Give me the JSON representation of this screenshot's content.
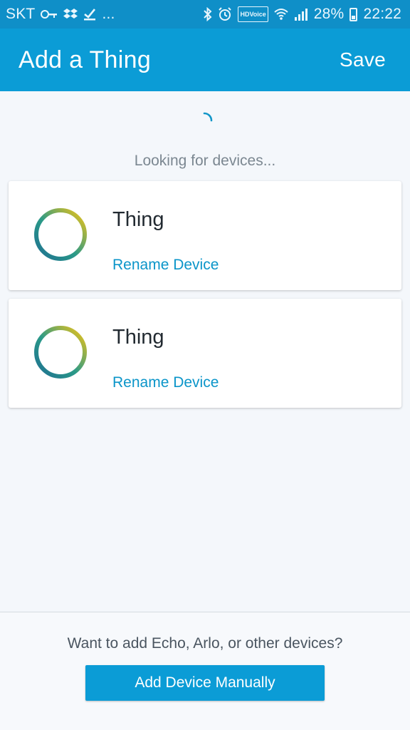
{
  "status_bar": {
    "carrier": "SKT",
    "more": "...",
    "battery_percent": "28%",
    "time": "22:22",
    "hd_voice_top": "HD",
    "hd_voice_bottom": "Voice",
    "icons": [
      "key-icon",
      "dropbox-icon",
      "check-icon",
      "bluetooth-icon",
      "alarm-icon",
      "hd-voice-icon",
      "wifi-icon",
      "signal-icon",
      "battery-icon"
    ]
  },
  "app_bar": {
    "title": "Add a Thing",
    "save_label": "Save"
  },
  "discovery": {
    "status_text": "Looking for devices..."
  },
  "devices": [
    {
      "name": "Thing",
      "rename_label": "Rename Device"
    },
    {
      "name": "Thing",
      "rename_label": "Rename Device"
    }
  ],
  "footer": {
    "prompt": "Want to add Echo, Arlo, or other devices?",
    "button_label": "Add Device Manually"
  },
  "colors": {
    "status_bar": "#0f8fc8",
    "app_bar": "#0b9cd6",
    "link": "#0b95c9",
    "ring_gradient": [
      "#1f7f96",
      "#f2c21b"
    ]
  }
}
